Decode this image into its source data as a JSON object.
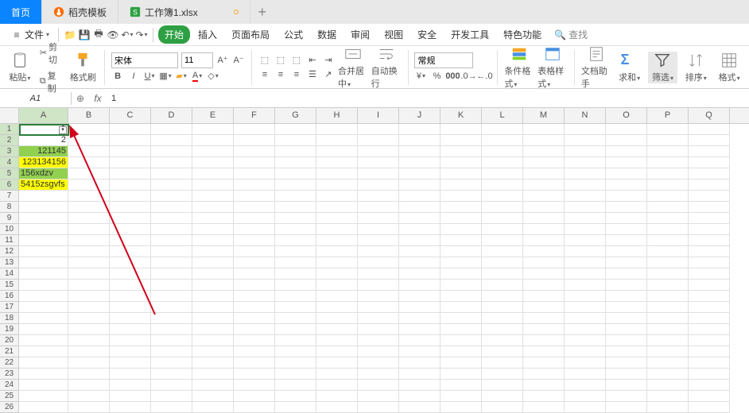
{
  "tabs": {
    "home": "首页",
    "template": "稻壳模板",
    "workbook": "工作簿1.xlsx"
  },
  "file_menu": {
    "label": "文件"
  },
  "menu": {
    "start": "开始",
    "insert": "插入",
    "page_layout": "页面布局",
    "formulas": "公式",
    "data": "数据",
    "review": "审阅",
    "view": "视图",
    "security": "安全",
    "dev_tools": "开发工具",
    "special": "特色功能",
    "search": "查找"
  },
  "ribbon": {
    "paste": "粘贴",
    "cut": "剪切",
    "copy": "复制",
    "format_painter": "格式刷",
    "font": "宋体",
    "font_size": "11",
    "merge_center": "合并居中",
    "wrap_text": "自动换行",
    "number_format": "常规",
    "cond_format": "条件格式",
    "table_styles": "表格样式",
    "doc_assist": "文档助手",
    "sum": "求和",
    "filter": "筛选",
    "sort": "排序",
    "format": "格式"
  },
  "name_box": "A1",
  "formula": "1",
  "columns": [
    "A",
    "B",
    "C",
    "D",
    "E",
    "F",
    "G",
    "H",
    "I",
    "J",
    "K",
    "L",
    "M",
    "N",
    "O",
    "P",
    "Q"
  ],
  "row_count": 26,
  "cells": {
    "a1": "1",
    "a2": "2",
    "a3": "121145",
    "a4": "123134156",
    "a5": "156xdzv",
    "a6": "5415zsgvfs"
  },
  "highlight": {
    "a3": "green",
    "a4": "yellow",
    "a5": "green",
    "a6": "yellow"
  }
}
